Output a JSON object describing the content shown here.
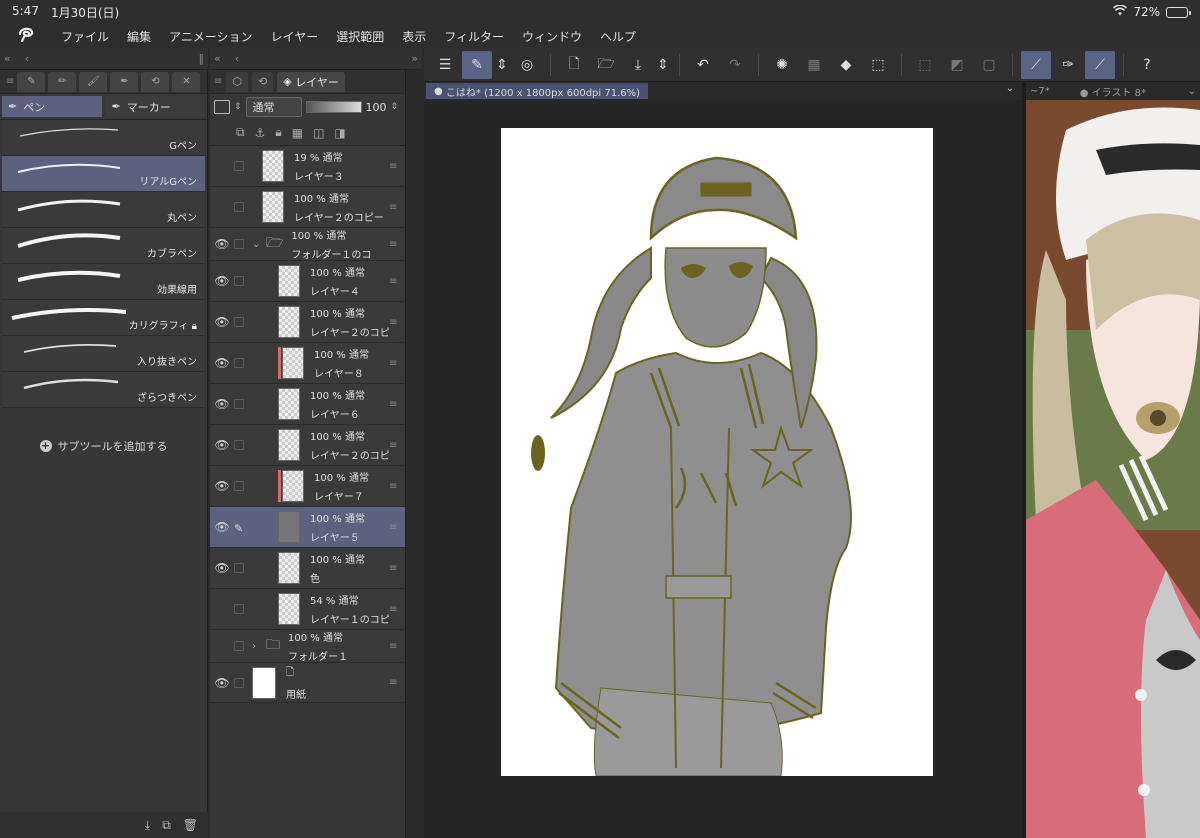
{
  "status": {
    "time": "5:47",
    "date": "1月30日(日)",
    "battery": "72%",
    "battery_level": 0.72
  },
  "menu": [
    "ファイル",
    "編集",
    "アニメーション",
    "レイヤー",
    "選択範囲",
    "表示",
    "フィルター",
    "ウィンドウ",
    "ヘルプ"
  ],
  "brushes": {
    "categories": [
      "ペン",
      "マーカー"
    ],
    "items": [
      "Gペン",
      "リアルGペン",
      "丸ペン",
      "カブラペン",
      "効果線用",
      "カリグラフィ",
      "入り抜きペン",
      "ざらつきペン"
    ],
    "add_subtool": "サブツールを追加する"
  },
  "layers": {
    "tab_label": "レイヤー",
    "blend_mode": "通常",
    "opacity": "100",
    "items": [
      {
        "opacity": "19 % 通常",
        "name": "レイヤー３"
      },
      {
        "opacity": "100 % 通常",
        "name": "レイヤー２のコピー"
      },
      {
        "opacity": "100 % 通常",
        "name": "フォルダー１のコ"
      },
      {
        "opacity": "100 % 通常",
        "name": "レイヤー４"
      },
      {
        "opacity": "100 % 通常",
        "name": "レイヤー２のコピ"
      },
      {
        "opacity": "100 % 通常",
        "name": "レイヤー８"
      },
      {
        "opacity": "100 % 通常",
        "name": "レイヤー６"
      },
      {
        "opacity": "100 % 通常",
        "name": "レイヤー２のコピ"
      },
      {
        "opacity": "100 % 通常",
        "name": "レイヤー７"
      },
      {
        "opacity": "100 % 通常",
        "name": "レイヤー５"
      },
      {
        "opacity": "100 % 通常",
        "name": "色"
      },
      {
        "opacity": "54 % 通常",
        "name": "レイヤー１のコピ"
      },
      {
        "opacity": "100 % 通常",
        "name": "フォルダー１"
      },
      {
        "opacity": "",
        "name": "用紙"
      }
    ]
  },
  "document": {
    "tab": "こはね* (1200 x 1800px 600dpi 71.6%)"
  },
  "subview": {
    "tab1": "~7*",
    "tab2": "イラスト 8*"
  },
  "colors": {
    "accent": "#5b617e",
    "line": "#6b6320",
    "fill": "#8f8f8f"
  }
}
